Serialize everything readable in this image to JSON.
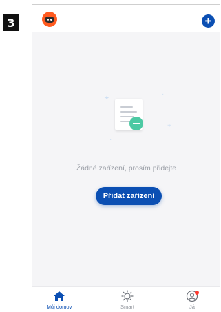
{
  "step_badge": "3",
  "header": {
    "logo_icon": "robot-logo-icon",
    "add_icon": "plus-circle-icon",
    "add_symbol": "+"
  },
  "empty_state": {
    "illustration_icon": "empty-document-icon",
    "message": "Žádné zařízení, prosím přidejte",
    "button_label": "Přidat zařízení"
  },
  "tabs": [
    {
      "label": "Můj domov",
      "icon": "home-icon",
      "active": true
    },
    {
      "label": "Smart",
      "icon": "sun-icon",
      "active": false
    },
    {
      "label": "Já",
      "icon": "profile-icon",
      "active": false
    }
  ],
  "colors": {
    "accent": "#0b4fb3",
    "logo": "#ff5a1f",
    "badge_green": "#4cc9a3",
    "notification": "#ff3b30"
  }
}
